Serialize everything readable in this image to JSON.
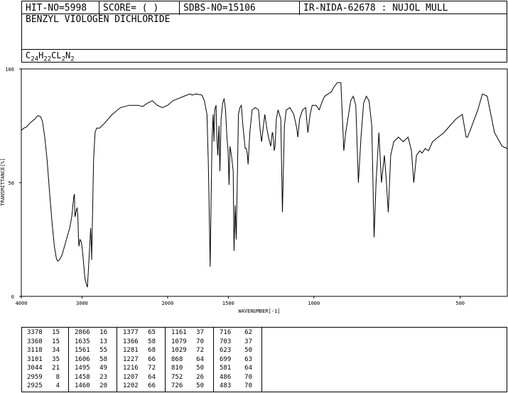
{
  "header": {
    "hit_no": "HIT-NO=5998",
    "score": "SCORE=  (   )",
    "sdbs_no": "SDBS-NO=15106",
    "ir_nida": "IR-NIDA-62678 : NUJOL MULL"
  },
  "compound_name": "BENZYL VIOLOGEN DICHLORIDE",
  "formula": {
    "parts": [
      {
        "el": "C",
        "n": "24"
      },
      {
        "el": "H",
        "n": "22"
      },
      {
        "el": "CL",
        "n": "2"
      },
      {
        "el": "N",
        "n": "2"
      }
    ]
  },
  "chart_data": {
    "type": "line",
    "xlabel": "WAVENUMBER[-1]",
    "ylabel": "TRANSMITTANCE[%]",
    "xlim": [
      4000,
      400
    ],
    "ylim": [
      0,
      100
    ],
    "x_ticks": [
      "4000",
      "3000",
      "2000",
      "1500",
      "1000",
      "500"
    ],
    "x_tick_values": [
      4000,
      3000,
      2000,
      1500,
      1000,
      500
    ],
    "y_ticks": [
      "0",
      "50",
      "100"
    ],
    "y_tick_values": [
      0,
      50,
      100
    ],
    "series": [
      {
        "points": [
          [
            4000,
            73
          ],
          [
            3950,
            74
          ],
          [
            3900,
            74.5
          ],
          [
            3850,
            76
          ],
          [
            3800,
            77
          ],
          [
            3750,
            78
          ],
          [
            3700,
            79.5
          ],
          [
            3650,
            79
          ],
          [
            3620,
            77
          ],
          [
            3580,
            70
          ],
          [
            3540,
            60
          ],
          [
            3500,
            46
          ],
          [
            3460,
            33
          ],
          [
            3420,
            22
          ],
          [
            3390,
            17
          ],
          [
            3378,
            16
          ],
          [
            3368,
            15.5
          ],
          [
            3340,
            16
          ],
          [
            3300,
            18
          ],
          [
            3260,
            22
          ],
          [
            3220,
            26
          ],
          [
            3180,
            30
          ],
          [
            3150,
            35
          ],
          [
            3130,
            41
          ],
          [
            3118,
            44
          ],
          [
            3110,
            45
          ],
          [
            3105,
            38
          ],
          [
            3101,
            35
          ],
          [
            3080,
            38
          ],
          [
            3070,
            39
          ],
          [
            3060,
            35
          ],
          [
            3050,
            25
          ],
          [
            3044,
            22
          ],
          [
            3030,
            25
          ],
          [
            3010,
            24
          ],
          [
            2990,
            19
          ],
          [
            2970,
            12
          ],
          [
            2959,
            8
          ],
          [
            2945,
            6
          ],
          [
            2925,
            4
          ],
          [
            2910,
            12
          ],
          [
            2890,
            24
          ],
          [
            2880,
            30
          ],
          [
            2870,
            22
          ],
          [
            2866,
            16
          ],
          [
            2855,
            35
          ],
          [
            2840,
            60
          ],
          [
            2820,
            72
          ],
          [
            2800,
            74
          ],
          [
            2760,
            74
          ],
          [
            2700,
            76
          ],
          [
            2650,
            78
          ],
          [
            2600,
            80
          ],
          [
            2500,
            83
          ],
          [
            2400,
            84
          ],
          [
            2300,
            84
          ],
          [
            2250,
            83.5
          ],
          [
            2200,
            85
          ],
          [
            2150,
            86
          ],
          [
            2100,
            84
          ],
          [
            2050,
            83
          ],
          [
            2000,
            84
          ],
          [
            1950,
            86
          ],
          [
            1900,
            87
          ],
          [
            1850,
            88
          ],
          [
            1800,
            89
          ],
          [
            1780,
            88.5
          ],
          [
            1750,
            89
          ],
          [
            1700,
            88.5
          ],
          [
            1680,
            86
          ],
          [
            1660,
            80
          ],
          [
            1650,
            60
          ],
          [
            1640,
            30
          ],
          [
            1635,
            13
          ],
          [
            1628,
            40
          ],
          [
            1620,
            70
          ],
          [
            1612,
            80
          ],
          [
            1606,
            68
          ],
          [
            1600,
            82
          ],
          [
            1590,
            84
          ],
          [
            1585,
            72
          ],
          [
            1577,
            62
          ],
          [
            1568,
            75
          ],
          [
            1561,
            55
          ],
          [
            1552,
            78
          ],
          [
            1540,
            85
          ],
          [
            1530,
            87
          ],
          [
            1520,
            82
          ],
          [
            1510,
            70
          ],
          [
            1502,
            64
          ],
          [
            1495,
            49
          ],
          [
            1488,
            66
          ],
          [
            1478,
            62
          ],
          [
            1466,
            55
          ],
          [
            1460,
            20
          ],
          [
            1452,
            40
          ],
          [
            1445,
            25
          ],
          [
            1430,
            80
          ],
          [
            1420,
            83
          ],
          [
            1410,
            84
          ],
          [
            1400,
            75
          ],
          [
            1385,
            65
          ],
          [
            1377,
            65
          ],
          [
            1370,
            62
          ],
          [
            1366,
            58
          ],
          [
            1355,
            72
          ],
          [
            1340,
            82
          ],
          [
            1320,
            83
          ],
          [
            1300,
            82
          ],
          [
            1290,
            73
          ],
          [
            1281,
            68
          ],
          [
            1270,
            75
          ],
          [
            1262,
            80
          ],
          [
            1250,
            74
          ],
          [
            1240,
            70
          ],
          [
            1227,
            66
          ],
          [
            1218,
            72
          ],
          [
            1216,
            72
          ],
          [
            1210,
            68
          ],
          [
            1207,
            64
          ],
          [
            1202,
            66
          ],
          [
            1195,
            78
          ],
          [
            1185,
            82
          ],
          [
            1170,
            78
          ],
          [
            1161,
            37
          ],
          [
            1150,
            75
          ],
          [
            1140,
            82
          ],
          [
            1120,
            83
          ],
          [
            1100,
            80
          ],
          [
            1085,
            74
          ],
          [
            1079,
            70
          ],
          [
            1070,
            78
          ],
          [
            1055,
            82
          ],
          [
            1040,
            83
          ],
          [
            1029,
            72
          ],
          [
            1018,
            80
          ],
          [
            1008,
            84
          ],
          [
            990,
            84
          ],
          [
            975,
            82
          ],
          [
            960,
            86
          ],
          [
            950,
            88
          ],
          [
            935,
            89
          ],
          [
            920,
            90
          ],
          [
            910,
            92
          ],
          [
            895,
            94
          ],
          [
            880,
            94
          ],
          [
            868,
            64
          ],
          [
            860,
            72
          ],
          [
            840,
            86
          ],
          [
            830,
            88
          ],
          [
            820,
            84
          ],
          [
            810,
            50
          ],
          [
            800,
            70
          ],
          [
            790,
            85
          ],
          [
            780,
            88
          ],
          [
            770,
            86
          ],
          [
            760,
            75
          ],
          [
            752,
            26
          ],
          [
            745,
            50
          ],
          [
            735,
            72
          ],
          [
            726,
            50
          ],
          [
            716,
            62
          ],
          [
            710,
            52
          ],
          [
            703,
            37
          ],
          [
            695,
            62
          ],
          [
            685,
            68
          ],
          [
            670,
            70
          ],
          [
            655,
            68
          ],
          [
            640,
            70
          ],
          [
            630,
            64
          ],
          [
            623,
            50
          ],
          [
            615,
            62
          ],
          [
            605,
            64
          ],
          [
            599,
            63
          ],
          [
            590,
            65
          ],
          [
            581,
            64
          ],
          [
            570,
            68
          ],
          [
            555,
            70
          ],
          [
            540,
            72
          ],
          [
            525,
            75
          ],
          [
            510,
            78
          ],
          [
            495,
            80
          ],
          [
            486,
            70
          ],
          [
            483,
            70
          ],
          [
            475,
            74
          ],
          [
            460,
            82
          ],
          [
            450,
            89
          ],
          [
            440,
            88
          ],
          [
            425,
            72
          ],
          [
            410,
            66
          ],
          [
            400,
            65
          ]
        ]
      }
    ]
  },
  "peak_table": {
    "columns": [
      [
        [
          "3378",
          "15"
        ],
        [
          "3368",
          "15"
        ],
        [
          "3118",
          "34"
        ],
        [
          "3101",
          "35"
        ],
        [
          "3044",
          "21"
        ],
        [
          "2959",
          "8"
        ],
        [
          "2925",
          "4"
        ]
      ],
      [
        [
          "2866",
          "16"
        ],
        [
          "1635",
          "13"
        ],
        [
          "1561",
          "55"
        ],
        [
          "1606",
          "58"
        ],
        [
          "1495",
          "49"
        ],
        [
          "1458",
          "23"
        ],
        [
          "1460",
          "20"
        ]
      ],
      [
        [
          "1377",
          "65"
        ],
        [
          "1366",
          "58"
        ],
        [
          "1281",
          "68"
        ],
        [
          "1227",
          "66"
        ],
        [
          "1216",
          "72"
        ],
        [
          "1207",
          "64"
        ],
        [
          "1202",
          "66"
        ]
      ],
      [
        [
          "1161",
          "37"
        ],
        [
          "1079",
          "70"
        ],
        [
          "1029",
          "72"
        ],
        [
          "868",
          "64"
        ],
        [
          "810",
          "50"
        ],
        [
          "752",
          "26"
        ],
        [
          "726",
          "50"
        ]
      ],
      [
        [
          "716",
          "62"
        ],
        [
          "703",
          "37"
        ],
        [
          "623",
          "50"
        ],
        [
          "699",
          "63"
        ],
        [
          "581",
          "64"
        ],
        [
          "486",
          "70"
        ],
        [
          "483",
          "70"
        ]
      ]
    ]
  }
}
